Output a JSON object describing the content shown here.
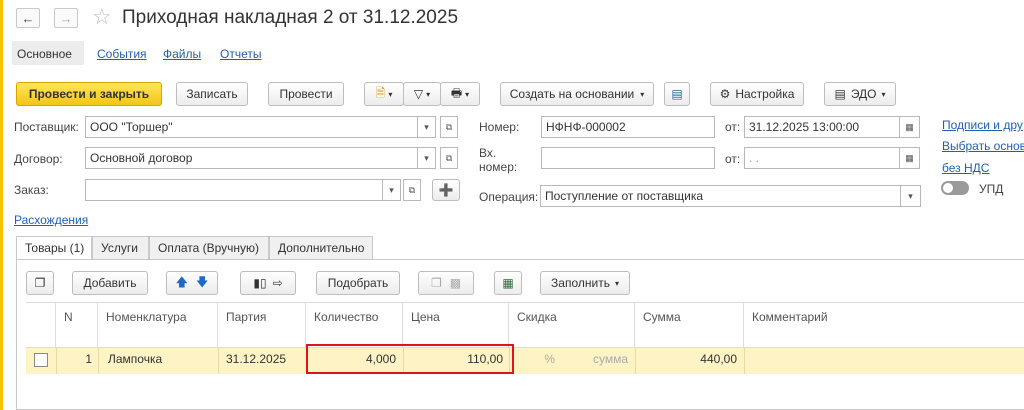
{
  "window": {
    "title": "Приходная накладная 2 от 31.12.2025"
  },
  "top_tabs": [
    {
      "label": "Основное"
    },
    {
      "label": "События"
    },
    {
      "label": "Файлы"
    },
    {
      "label": "Отчеты"
    }
  ],
  "toolbar": {
    "post_close": "Провести и закрыть",
    "save": "Записать",
    "post": "Провести",
    "create_based": "Создать на основании",
    "settings": "Настройка",
    "edo": "ЭДО"
  },
  "form": {
    "supplier_label": "Поставщик:",
    "supplier_value": "ООО \"Торшер\"",
    "contract_label": "Договор:",
    "contract_value": "Основной договор",
    "order_label": "Заказ:",
    "order_value": "",
    "number_label": "Номер:",
    "number_value": "НФНФ-000002",
    "date_prefix": "от:",
    "date_value": "31.12.2025 13:00:00",
    "in_number_label_1": "Вх.",
    "in_number_label_2": "номер:",
    "in_number_value": "",
    "in_date_prefix": "от:",
    "in_date_value": " .  .",
    "operation_label": "Операция:",
    "operation_value": "Поступление от поставщика",
    "discrepancies_link": "Расхождения"
  },
  "right_links": {
    "signatures": "Подписи и дру",
    "choose_basis": "Выбрать основ",
    "vat": "без НДС",
    "upd_label": "УПД"
  },
  "doc_tabs": [
    {
      "label": "Товары (1)"
    },
    {
      "label": "Услуги"
    },
    {
      "label": "Оплата (Вручную)"
    },
    {
      "label": "Дополнительно"
    }
  ],
  "table_toolbar": {
    "add": "Добавить",
    "pick": "Подобрать",
    "fill": "Заполнить"
  },
  "table": {
    "columns": [
      "N",
      "Номенклатура",
      "Партия",
      "Количество",
      "Цена",
      "Скидка",
      "Сумма",
      "Комментарий"
    ],
    "rows": [
      {
        "n": "1",
        "item": "Лампочка",
        "batch": "31.12.2025",
        "qty": "4,000",
        "price": "110,00",
        "discount_pct": "%",
        "discount_sum": "сумма",
        "sum": "440,00",
        "comment": ""
      }
    ]
  }
}
